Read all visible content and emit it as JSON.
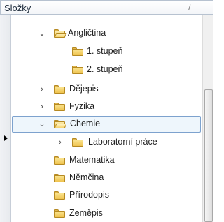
{
  "header": {
    "title": "Složky",
    "sort_glyph": "/"
  },
  "tree": {
    "items": [
      {
        "label": "Angličtina",
        "icon": "folder-open-icon",
        "expander": "chevron-down-icon"
      },
      {
        "label": "1. stupeň",
        "icon": "folder-icon"
      },
      {
        "label": "2. stupeň",
        "icon": "folder-icon"
      },
      {
        "label": "Dějepis",
        "icon": "folder-icon",
        "expander": "chevron-right-icon"
      },
      {
        "label": "Fyzika",
        "icon": "folder-icon",
        "expander": "chevron-right-icon"
      },
      {
        "label": "Chemie",
        "icon": "folder-open-icon",
        "expander": "chevron-down-icon",
        "selected": true
      },
      {
        "label": "Laboratorní práce",
        "icon": "folder-icon",
        "expander": "chevron-right-icon"
      },
      {
        "label": "Matematika",
        "icon": "folder-icon"
      },
      {
        "label": "Němčina",
        "icon": "folder-icon"
      },
      {
        "label": "Přírodopis",
        "icon": "folder-icon"
      },
      {
        "label": "Zeměpis",
        "icon": "folder-icon"
      }
    ]
  },
  "colors": {
    "selection_border": "#7da2ce",
    "selection_fill": "#eef6fc",
    "folder_yellow": "#efc34f",
    "header_border": "#b7c2d0"
  },
  "icons": {
    "row_marker": "row-pointer-icon",
    "scroll_grip": "grip-icon"
  }
}
